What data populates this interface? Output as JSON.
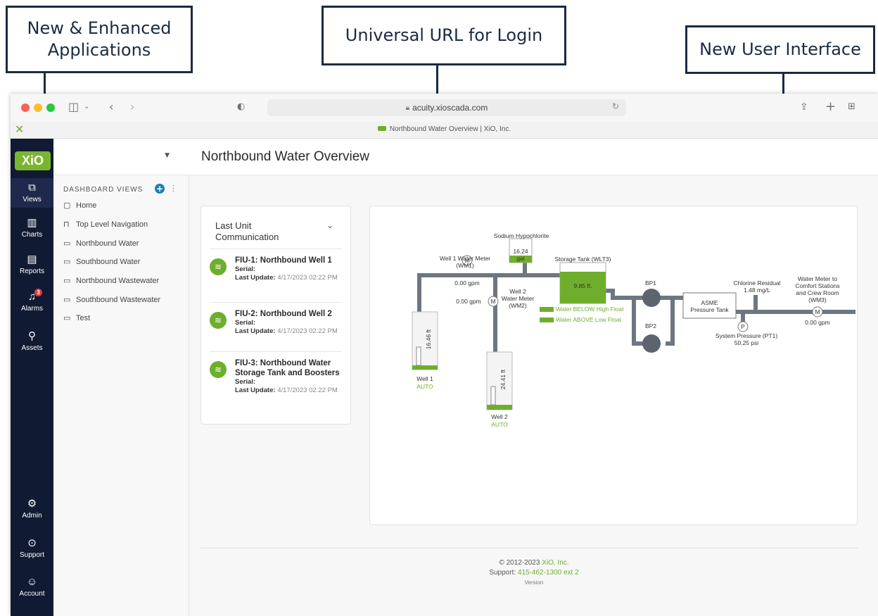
{
  "callouts": {
    "apps": "New & Enhanced\nApplications",
    "url": "Universal URL for Login",
    "ui": "New User Interface"
  },
  "browser": {
    "url": "acuity.xioscada.com",
    "tab_title": "Northbound Water Overview | XiO, Inc."
  },
  "nav": {
    "logo": "XiO",
    "items": [
      {
        "label": "Views",
        "icon": "views-icon"
      },
      {
        "label": "Charts",
        "icon": "charts-icon"
      },
      {
        "label": "Reports",
        "icon": "reports-icon"
      },
      {
        "label": "Alarms",
        "icon": "alarm-bell-icon",
        "badge": "3"
      },
      {
        "label": "Assets",
        "icon": "assets-icon"
      },
      {
        "label": "Admin",
        "icon": "gear-icon"
      },
      {
        "label": "Support",
        "icon": "help-icon"
      },
      {
        "label": "Account",
        "icon": "account-icon"
      }
    ]
  },
  "dashboard": {
    "header": "DASHBOARD VIEWS",
    "items": [
      {
        "label": "Home",
        "icon": "home-icon"
      },
      {
        "label": "Top Level Navigation",
        "icon": "lock-icon"
      },
      {
        "label": "Northbound Water",
        "icon": "folder-icon"
      },
      {
        "label": "Southbound Water",
        "icon": "folder-icon"
      },
      {
        "label": "Northbound Wastewater",
        "icon": "folder-icon"
      },
      {
        "label": "Southbound Wastewater",
        "icon": "folder-icon"
      },
      {
        "label": "Test",
        "icon": "folder-icon"
      }
    ]
  },
  "page": {
    "title": "Northbound Water Overview"
  },
  "comm": {
    "header": "Last Unit Communication",
    "serial_label": "Serial:",
    "update_label": "Last Update:",
    "units": [
      {
        "title": "FIU-1: Northbound Well 1",
        "last_update": "4/17/2023 02:22 PM"
      },
      {
        "title": "FIU-2: Northbound Well 2",
        "last_update": "4/17/2023 02:22 PM"
      },
      {
        "title": "FIU-3: Northbound Water Storage Tank and Boosters",
        "last_update": "4/17/2023 02:22 PM"
      }
    ]
  },
  "diagram": {
    "sodium": {
      "label": "Sodium Hypochlorite",
      "value": "16.24",
      "unit": "gal"
    },
    "storage_tank": {
      "label": "Storage Tank (WLT3)",
      "value": "9.85 ft."
    },
    "wm1": {
      "label": "Well 1 Water Meter\n(WM1)",
      "value": "0.00 gpm",
      "symbol": "M"
    },
    "wm2": {
      "label": "Well 2\nWater Meter\n(WM2)",
      "value": "0.00 gpm",
      "symbol": "M"
    },
    "wm3": {
      "label": "Water Meter to\nComfort Stations\nand Crew Room\n(WM3)",
      "value": "0.00 gpm",
      "symbol": "M"
    },
    "well1": {
      "label": "Well 1",
      "mode": "AUTO",
      "level": "16.46 ft"
    },
    "well2": {
      "label": "Well 2",
      "mode": "AUTO",
      "level": "24.41 ft"
    },
    "floats": [
      "Water BELOW High Float",
      "Water ABOVE Low Float"
    ],
    "bp1": "BP1",
    "bp2": "BP2",
    "pressure_tank": "ASME\nPressure Tank",
    "chlorine": {
      "label": "Chlorine Residual",
      "value": "1.48 mg/L"
    },
    "pt1": {
      "label": "System Pressure (PT1)",
      "value": "50.25 psi",
      "symbol": "P"
    }
  },
  "footer": {
    "copyright": "© 2012-2023",
    "company": "XiO, Inc.",
    "support_label": "Support:",
    "support_phone": "415-462-1300 ext 2",
    "version": "Version"
  }
}
